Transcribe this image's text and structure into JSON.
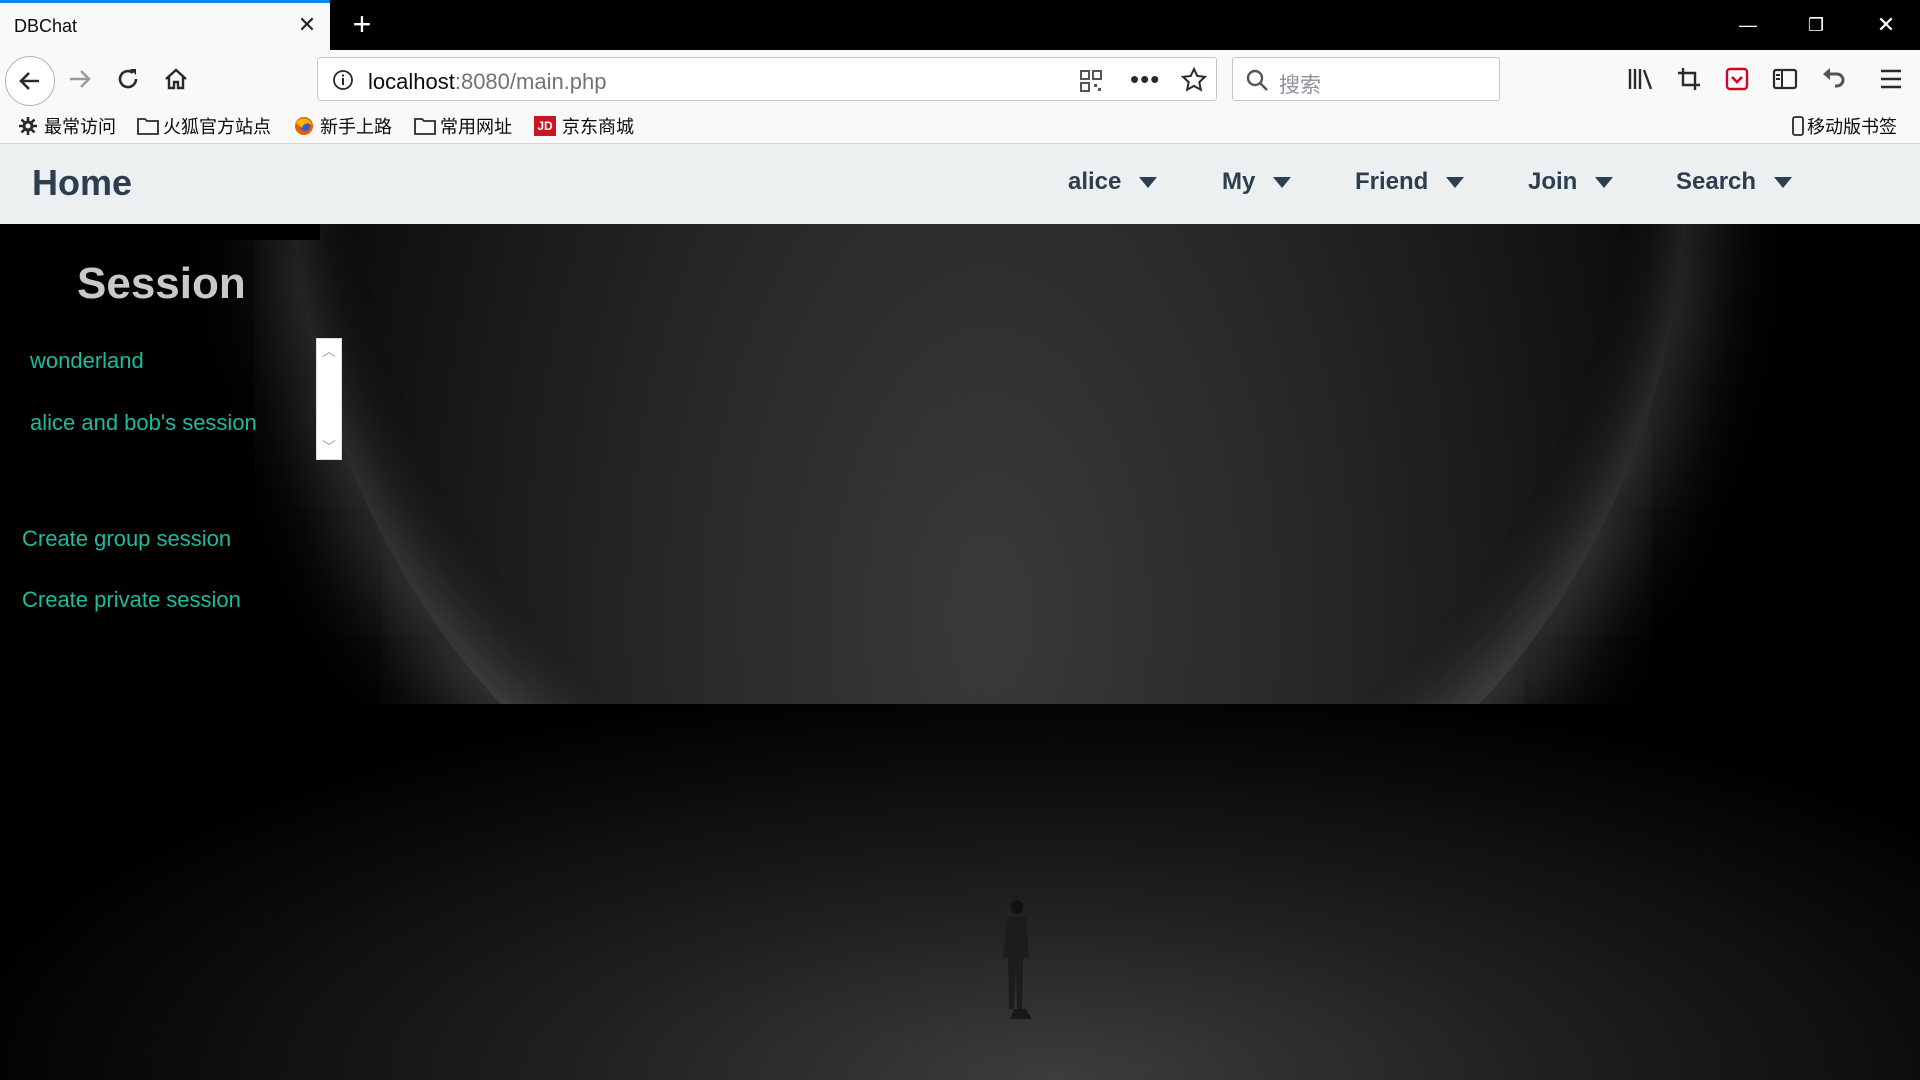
{
  "browser": {
    "tab_title": "DBChat",
    "url_host": "localhost",
    "url_rest": ":8080/main.php",
    "search_placeholder": "搜索",
    "bookmarks": [
      "最常访问",
      "火狐官方站点",
      "新手上路",
      "常用网址",
      "京东商城"
    ],
    "mobile_bookmarks": "移动版书签",
    "jd_badge": "JD"
  },
  "nav": {
    "home": "Home",
    "menus": [
      "alice",
      "My",
      "Friend",
      "Join",
      "Search"
    ]
  },
  "sidebar": {
    "title": "Session",
    "sessions": [
      "wonderland",
      "alice and bob's session"
    ],
    "actions": [
      "Create group session",
      "Create private session"
    ]
  },
  "colors": {
    "link": "#1abc9c",
    "nav_bg": "#ecf0f1",
    "nav_text": "#2c3e50"
  }
}
